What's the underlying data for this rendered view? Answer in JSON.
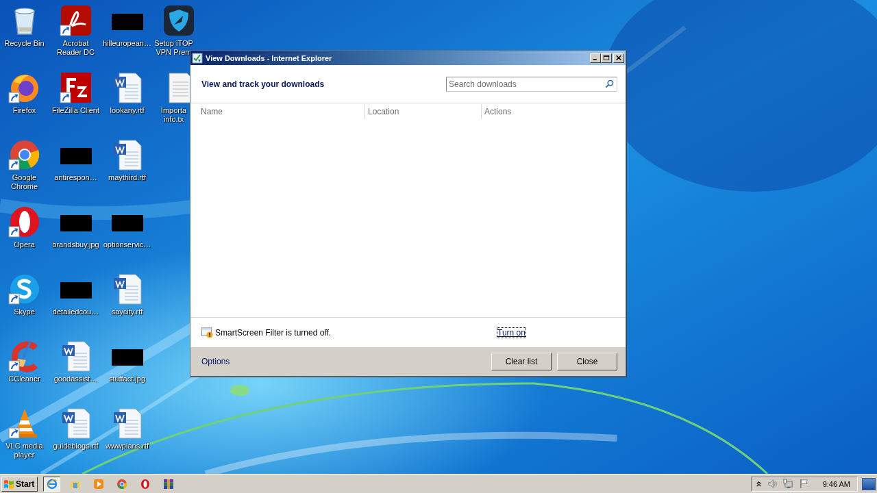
{
  "desktop": {
    "columns": [
      [
        {
          "label": "Recycle Bin",
          "kind": "recycle",
          "shortcut": false
        },
        {
          "label": "Firefox",
          "kind": "firefox",
          "shortcut": true
        },
        {
          "label": "Google Chrome",
          "kind": "chrome",
          "shortcut": true
        },
        {
          "label": "Opera",
          "kind": "opera",
          "shortcut": true
        },
        {
          "label": "Skype",
          "kind": "skype",
          "shortcut": true
        },
        {
          "label": "CCleaner",
          "kind": "ccleaner",
          "shortcut": true
        },
        {
          "label": "VLC media player",
          "kind": "vlc",
          "shortcut": true
        }
      ],
      [
        {
          "label": "Acrobat Reader DC",
          "kind": "acrobat",
          "shortcut": true
        },
        {
          "label": "FileZilla Client",
          "kind": "filezilla",
          "shortcut": true
        },
        {
          "label": "antirespon…",
          "kind": "redacted",
          "shortcut": false
        },
        {
          "label": "brandsbuy.jpg",
          "kind": "redacted",
          "shortcut": false
        },
        {
          "label": "detailedcou…",
          "kind": "redacted",
          "shortcut": false
        },
        {
          "label": "goodassist…",
          "kind": "word",
          "shortcut": false
        },
        {
          "label": "guideblogs.rtf",
          "kind": "word",
          "shortcut": false
        }
      ],
      [
        {
          "label": "hilleuropean…",
          "kind": "redacted",
          "shortcut": false
        },
        {
          "label": "lookany.rtf",
          "kind": "word",
          "shortcut": false
        },
        {
          "label": "maythird.rtf",
          "kind": "word",
          "shortcut": false
        },
        {
          "label": "optionservic…",
          "kind": "redacted",
          "shortcut": false
        },
        {
          "label": "saycity.rtf",
          "kind": "word",
          "shortcut": false
        },
        {
          "label": "stuffact.jpg",
          "kind": "redacted",
          "shortcut": false
        },
        {
          "label": "wwwplans.rtf",
          "kind": "word",
          "shortcut": false
        }
      ],
      [
        {
          "label": "Setup iTOP VPN Prem",
          "kind": "itop",
          "shortcut": false
        },
        {
          "label": "Importa info.tx",
          "kind": "text",
          "shortcut": false
        }
      ]
    ]
  },
  "window": {
    "title": "View Downloads - Internet Explorer",
    "heading": "View and track your downloads",
    "search": {
      "placeholder": "Search downloads"
    },
    "columns": [
      "Name",
      "Location",
      "Actions"
    ],
    "smartscreen": {
      "message": "SmartScreen Filter is turned off.",
      "link": "Turn on"
    },
    "footer": {
      "link": "Options",
      "buttons": [
        "Clear list",
        "Close"
      ]
    }
  },
  "taskbar": {
    "start": "Start",
    "apps": [
      {
        "kind": "ie",
        "selected": true
      },
      {
        "kind": "explorer",
        "selected": false
      },
      {
        "kind": "media",
        "selected": false
      },
      {
        "kind": "chrome",
        "selected": false
      },
      {
        "kind": "opera",
        "selected": false
      },
      {
        "kind": "winrar",
        "selected": false
      }
    ],
    "clock": "9:46 AM"
  }
}
